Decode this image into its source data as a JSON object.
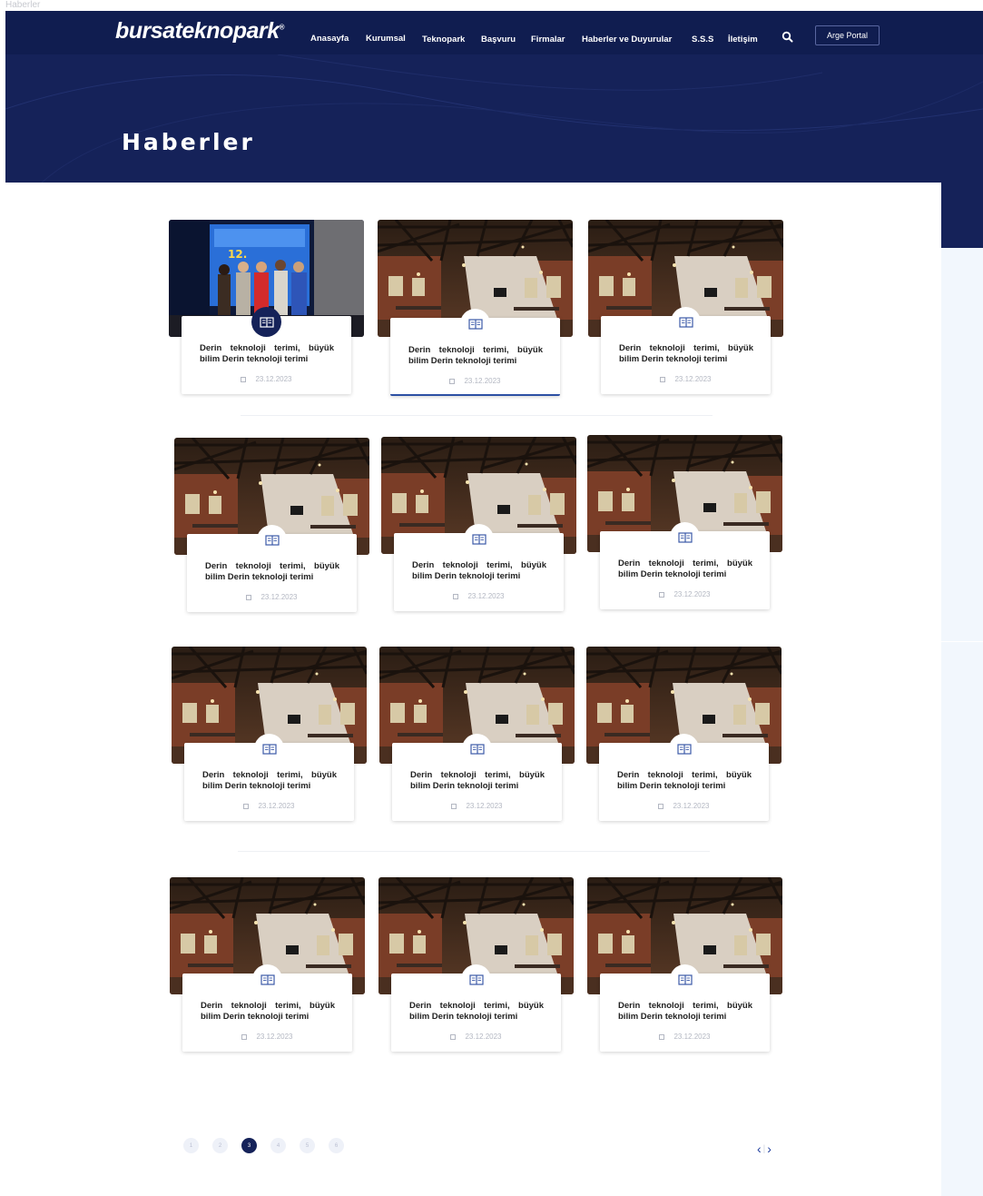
{
  "browser_tab_label": "Haberler",
  "header": {
    "logo_text": "bursateknopark",
    "logo_mark": "®",
    "nav": [
      "Anasayfa",
      "Kurumsal",
      "Teknopark",
      "Başvuru",
      "Firmalar",
      "Haberler ve Duyurular",
      "S.S.S",
      "İletişim"
    ],
    "search_icon": "search-icon",
    "portal_label": "Arge Portal",
    "page_title": "Haberler"
  },
  "cards": [
    {
      "title": "Derin teknoloji terimi, büyük bilim Derin teknoloji terimi",
      "date": "23.12.2023",
      "image": "event-photo"
    },
    {
      "title": "Derin teknoloji terimi, büyük bilim Derin teknoloji terimi",
      "date": "23.12.2023",
      "image": "loft-interior"
    },
    {
      "title": "Derin teknoloji terimi, büyük bilim Derin teknoloji terimi",
      "date": "23.12.2023",
      "image": "loft-interior"
    },
    {
      "title": "Derin teknoloji terimi, büyük bilim Derin teknoloji terimi",
      "date": "23.12.2023",
      "image": "loft-interior"
    },
    {
      "title": "Derin teknoloji terimi, büyük bilim Derin teknoloji terimi",
      "date": "23.12.2023",
      "image": "loft-interior"
    },
    {
      "title": "Derin teknoloji terimi, büyük bilim Derin teknoloji terimi",
      "date": "23.12.2023",
      "image": "loft-interior"
    },
    {
      "title": "Derin teknoloji terimi, büyük bilim Derin teknoloji terimi",
      "date": "23.12.2023",
      "image": "loft-interior"
    },
    {
      "title": "Derin teknoloji terimi, büyük bilim Derin teknoloji terimi",
      "date": "23.12.2023",
      "image": "loft-interior"
    },
    {
      "title": "Derin teknoloji terimi, büyük bilim Derin teknoloji terimi",
      "date": "23.12.2023",
      "image": "loft-interior"
    },
    {
      "title": "Derin teknoloji terimi, büyük bilim Derin teknoloji terimi",
      "date": "23.12.2023",
      "image": "loft-interior"
    },
    {
      "title": "Derin teknoloji terimi, büyük bilim Derin teknoloji terimi",
      "date": "23.12.2023",
      "image": "loft-interior"
    },
    {
      "title": "Derin teknoloji terimi, büyük bilim Derin teknoloji terimi",
      "date": "23.12.2023",
      "image": "loft-interior"
    }
  ],
  "pagination": {
    "pages": [
      "1",
      "2",
      "3",
      "4",
      "5",
      "6"
    ],
    "current": "3",
    "prev_label": "‹",
    "next_label": "›",
    "separator": "|"
  },
  "colors": {
    "brand_navy": "#152259",
    "topbar": "#101d50",
    "accent_blue": "#2c4fa3",
    "date_grey": "#b3b7c2"
  }
}
